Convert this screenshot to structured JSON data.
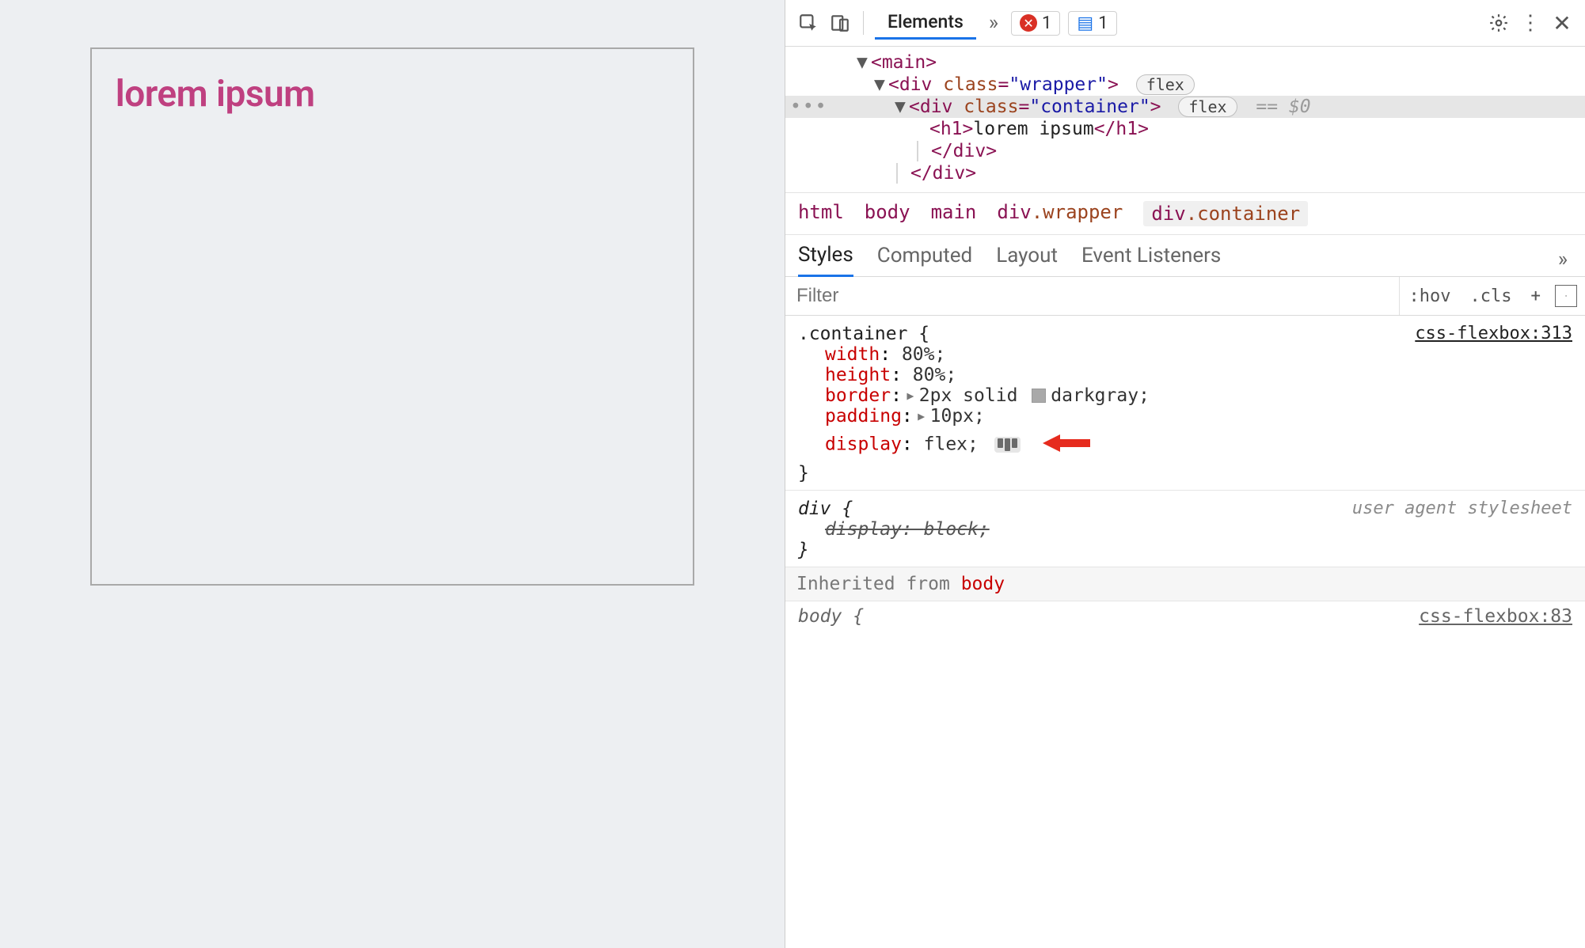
{
  "page": {
    "heading": "lorem ipsum"
  },
  "toolbar": {
    "tab_elements": "Elements",
    "errors_count": "1",
    "messages_count": "1"
  },
  "dom": {
    "main_open": "<main>",
    "wrapper_open_pre": "<div ",
    "class_kw": "class",
    "wrapper_class": "\"wrapper\"",
    "close_gt": ">",
    "container_class": "\"container\"",
    "flex_pill": "flex",
    "eq0": "== $0",
    "h1_open": "<h1>",
    "h1_text": "lorem ipsum",
    "h1_close": "</h1>",
    "div_close": "</div>"
  },
  "crumbs": {
    "c0": "html",
    "c1": "body",
    "c2": "main",
    "c3_tag": "div",
    "c3_cls": ".wrapper",
    "c4_tag": "div",
    "c4_cls": ".container"
  },
  "subtabs": {
    "styles": "Styles",
    "computed": "Computed",
    "layout": "Layout",
    "listeners": "Event Listeners"
  },
  "filter": {
    "placeholder": "Filter",
    "hov": ":hov",
    "cls": ".cls",
    "plus": "+"
  },
  "rules": {
    "container": {
      "selector": ".container {",
      "source": "css-flexbox:313",
      "width_p": "width",
      "width_v": "80%;",
      "height_p": "height",
      "height_v": "80%;",
      "border_p": "border",
      "border_v_pre": "2px solid ",
      "border_color": "darkgray",
      "border_end": ";",
      "padding_p": "padding",
      "padding_v": "10px;",
      "display_p": "display",
      "display_v": "flex;",
      "close": "}"
    },
    "div_ua": {
      "selector": "div {",
      "label": "user agent stylesheet",
      "decl": "display: block;",
      "close": "}"
    },
    "inherited_label": "Inherited from ",
    "inherited_from": "body",
    "body_peek_sel": "body {",
    "body_peek_src": "css-flexbox:83"
  }
}
